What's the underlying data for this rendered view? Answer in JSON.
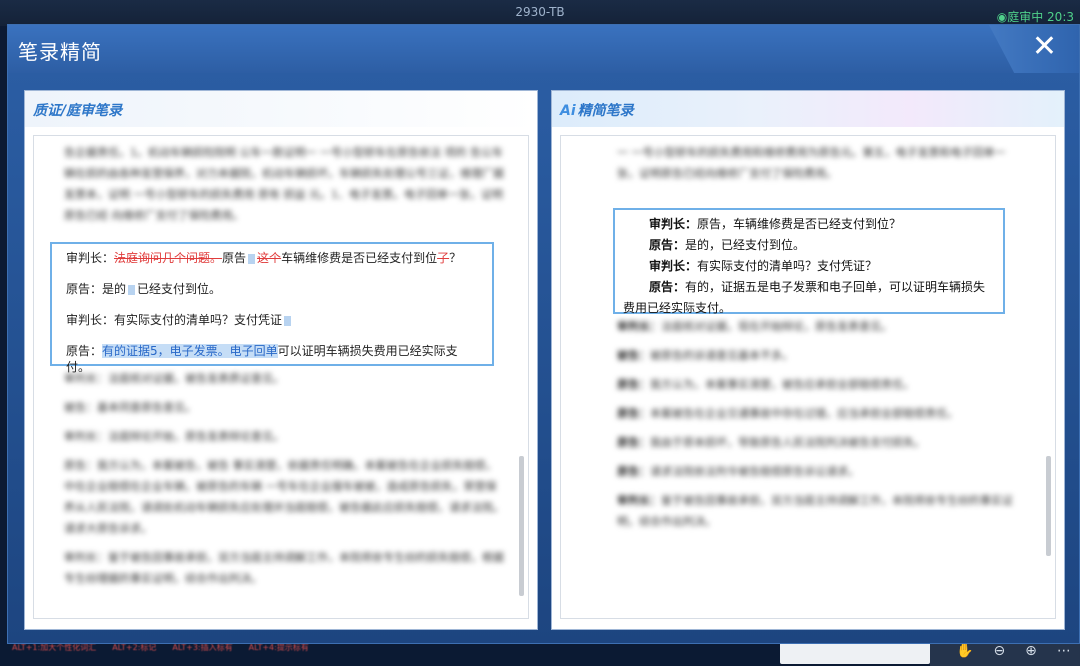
{
  "app": {
    "top_title": "2930-TB",
    "status": "◉庭审中 20:3"
  },
  "dialog": {
    "title": "笔录精简",
    "close_glyph": "✕"
  },
  "left_panel": {
    "title": "质证/庭审笔录",
    "highlight": {
      "judge_label": "审判长：",
      "judge_struck": "法庭询问几个问题。",
      "judge_mid": "原告",
      "judge_struck2": "这个",
      "judge_text": "车辆维修费是否已经支付到位",
      "judge_struck3": "了",
      "judge_end": "？",
      "plaintiff_label": "原告：",
      "plaintiff_text1": "是的",
      "plaintiff_text2": "已经支付到位。",
      "judge2_label": "审判长：",
      "judge2_text": "有实际支付的清单吗？支付凭证",
      "plaintiff2_label": "原告：",
      "plaintiff2_sel": "有的证据5，电子发票。电子回单",
      "plaintiff2_text": "可以证明车辆损失费用已经实际支付。"
    }
  },
  "right_panel": {
    "title": "精简笔录",
    "ai_badge": "Ai",
    "highlight": {
      "l1_label": "审判长：",
      "l1_text": "原告，车辆维修费是否已经支付到位？",
      "l2_label": "原告：",
      "l2_text": "是的，已经支付到位。",
      "l3_label": "审判长：",
      "l3_text": "有实际支付的清单吗？支付凭证？",
      "l4_label": "原告：",
      "l4_text": "有的，证据五是电子发票和电子回单，可以证明车辆损失费用已经实际支付。"
    }
  },
  "bottom": {
    "shortcuts": [
      "ALT+1:加大个性化词汇",
      "ALT+2:标记",
      "ALT+3:插入标有",
      "ALT+4:提示标有"
    ],
    "icons": [
      "hand-icon",
      "zoom-out-icon",
      "zoom-in-icon",
      "more-icon"
    ],
    "icon_glyphs": [
      "✋",
      "⊖",
      "⊕",
      "⋯"
    ]
  }
}
